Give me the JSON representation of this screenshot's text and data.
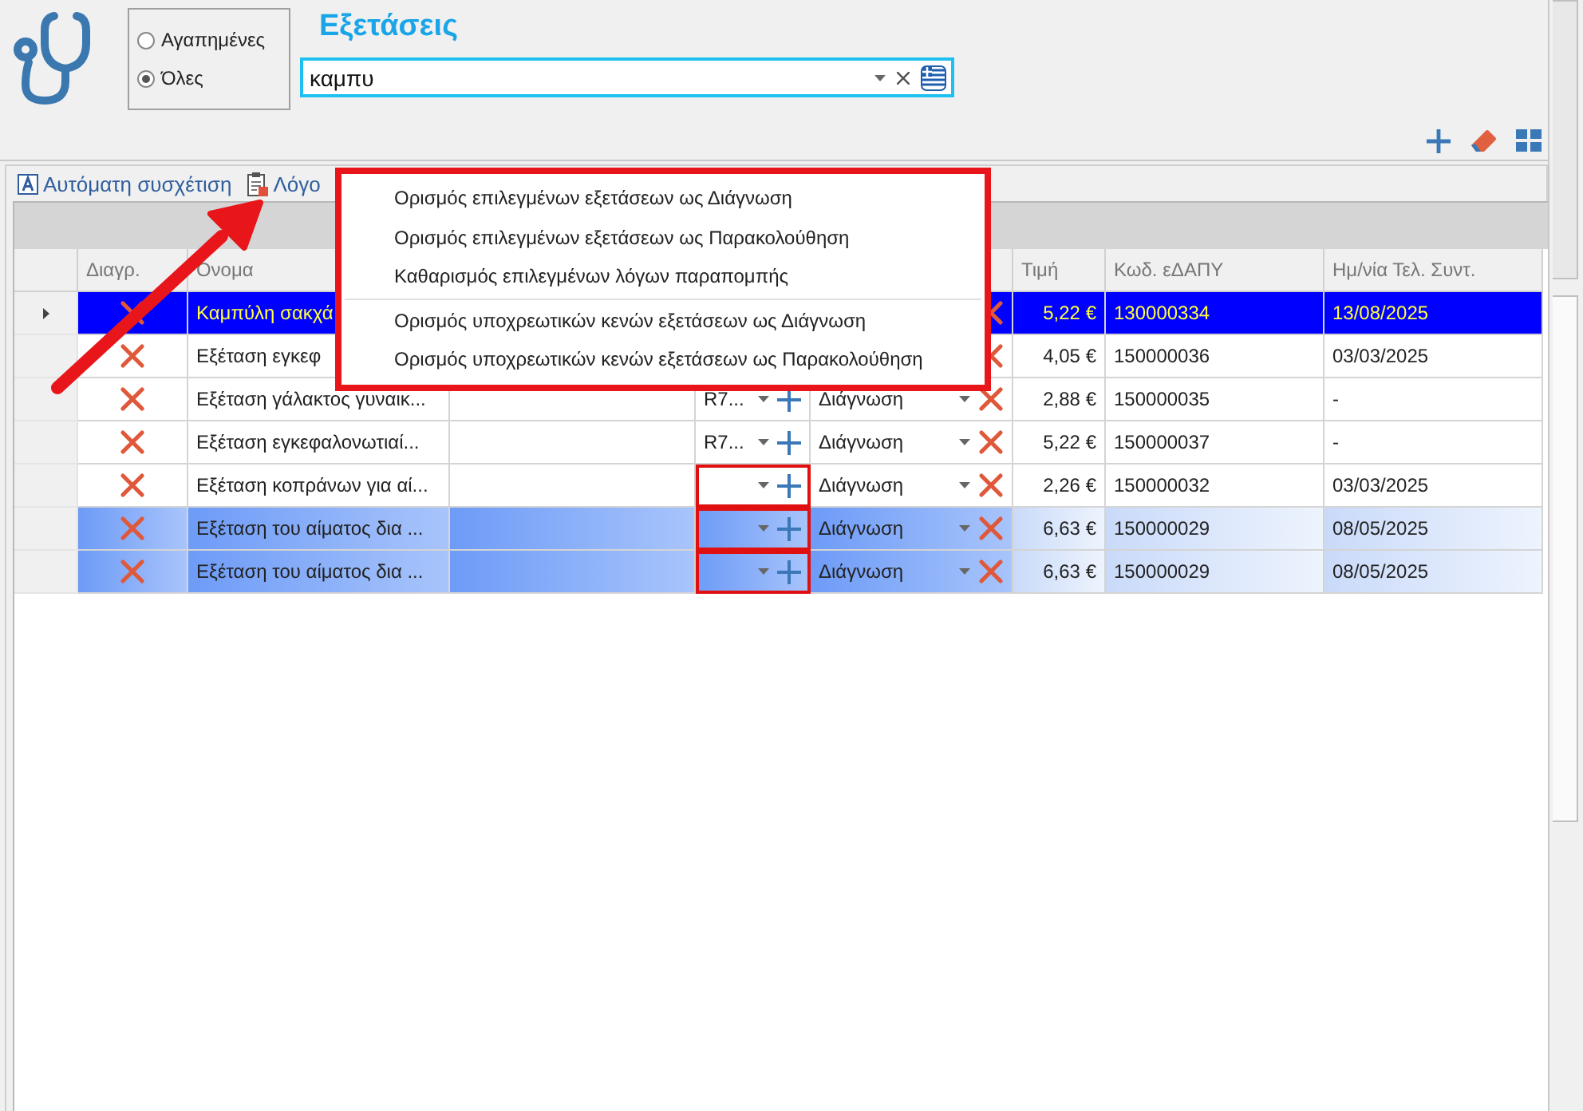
{
  "header": {
    "title": "Εξετάσεις",
    "filter": [
      {
        "label": "Αγαπημένες",
        "selected": false
      },
      {
        "label": "Όλες",
        "selected": true
      }
    ],
    "search": {
      "value": "καμπυ"
    }
  },
  "toolbar": {
    "buttons": [
      {
        "label": "Αυτόματη συσχέτιση",
        "kind": "auto"
      },
      {
        "label": "Λόγο",
        "kind": "reasons"
      }
    ]
  },
  "table": {
    "columns": [
      "Διαγρ.",
      "Όνομα",
      null,
      null,
      null,
      "Τιμή",
      "Κωδ. εΔΑΠΥ",
      "Ημ/νία Τελ. Συντ."
    ],
    "rows": [
      {
        "name": "Καμπύλη σακχά",
        "price": "5,22 €",
        "code": "130000334",
        "date": "13/08/2025",
        "focused": true,
        "selected": false
      },
      {
        "name": "Εξέταση εγκεφ",
        "price": "4,05 €",
        "code": "150000036",
        "date": "03/03/2025",
        "focused": false,
        "selected": false
      },
      {
        "name": "Εξέταση γάλακτος γυναικ...",
        "reason": "R7...",
        "type": "Διάγνωση",
        "price": "2,88 €",
        "code": "150000035",
        "date": "-",
        "focused": false,
        "selected": false,
        "invalid": false
      },
      {
        "name": "Εξέταση εγκεφαλονωτιαί...",
        "reason": "R7...",
        "type": "Διάγνωση",
        "price": "5,22 €",
        "code": "150000037",
        "date": "-",
        "focused": false,
        "selected": false,
        "invalid": false
      },
      {
        "name": "Εξέταση κοπράνων για αί...",
        "type": "Διάγνωση",
        "price": "2,26 €",
        "code": "150000032",
        "date": "03/03/2025",
        "focused": false,
        "selected": false,
        "invalid": true
      },
      {
        "name": "Εξέταση του αίματος δια ...",
        "type": "Διάγνωση",
        "price": "6,63 €",
        "code": "150000029",
        "date": "08/05/2025",
        "focused": false,
        "selected": true,
        "invalid": true
      },
      {
        "name": "Εξέταση του αίματος δια ...",
        "type": "Διάγνωση",
        "price": "6,63 €",
        "code": "150000029",
        "date": "08/05/2025",
        "focused": false,
        "selected": true,
        "invalid": true
      }
    ]
  },
  "context_menu": {
    "groups": [
      [
        "Ορισμός επιλεγμένων εξετάσεων ως Διάγνωση",
        "Ορισμός επιλεγμένων εξετάσεων ως Παρακολούθηση",
        "Καθαρισμός επιλεγμένων λόγων παραπομπής"
      ],
      [
        "Ορισμός υποχρεωτικών κενών εξετάσεων ως Διάγνωση",
        "Ορισμός υποχρεωτικών κενών εξετάσεων ως Παρακολούθηση"
      ]
    ]
  },
  "side_tabs": [
    {
      "selected": false
    },
    {
      "selected": true
    }
  ]
}
